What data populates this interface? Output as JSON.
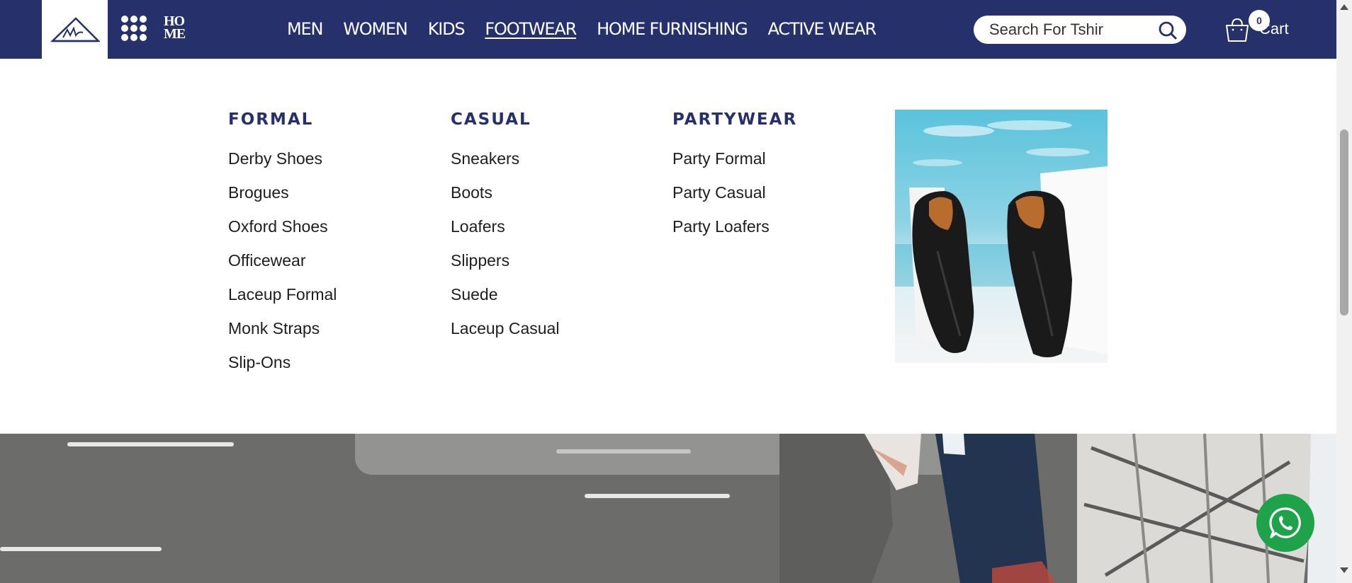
{
  "header": {
    "home_logo_line1": "HO",
    "home_logo_line2": "ME",
    "nav": [
      {
        "label": "MEN"
      },
      {
        "label": "WOMEN"
      },
      {
        "label": "KIDS"
      },
      {
        "label": "FOOTWEAR",
        "active": true
      },
      {
        "label": "HOME FURNISHING"
      },
      {
        "label": "ACTIVE WEAR"
      }
    ],
    "search": {
      "placeholder": "Search For Tshir"
    },
    "cart": {
      "count": "0",
      "label": "Cart"
    }
  },
  "mega_menu": {
    "columns": [
      {
        "title": "FORMAL",
        "items": [
          "Derby Shoes",
          "Brogues",
          "Oxford Shoes",
          "Officewear",
          "Laceup Formal",
          "Monk Straps",
          "Slip-Ons"
        ]
      },
      {
        "title": "CASUAL",
        "items": [
          "Sneakers",
          "Boots",
          "Loafers",
          "Slippers",
          "Suede",
          "Laceup Casual"
        ]
      },
      {
        "title": "PARTYWEAR",
        "items": [
          "Party Formal",
          "Party Casual",
          "Party Loafers"
        ]
      }
    ],
    "promo_icon": "black-loafers-image"
  },
  "colors": {
    "header_bg": "#26306a",
    "accent": "#26306a",
    "whatsapp": "#1fa34a"
  },
  "icons": {
    "grid": "grid-menu-icon",
    "search": "search-icon",
    "cart": "shopping-bag-icon",
    "whatsapp": "whatsapp-icon"
  }
}
